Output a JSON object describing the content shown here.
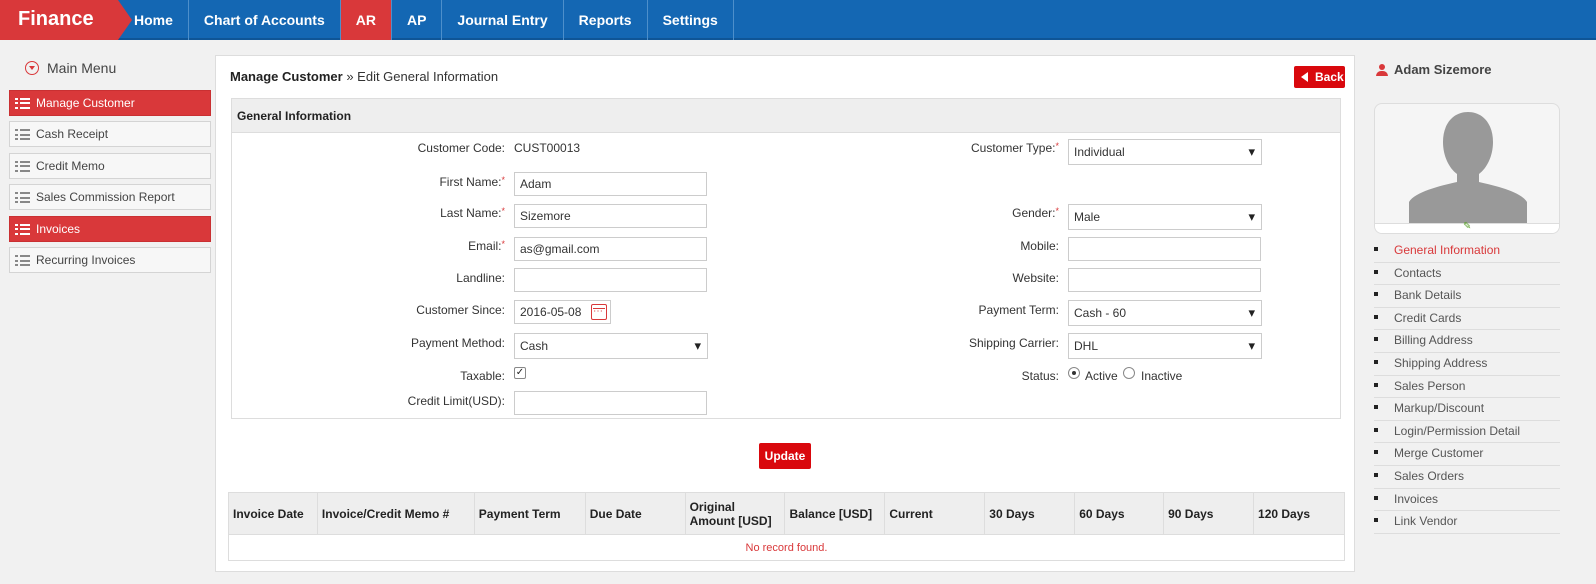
{
  "brand": "Finance",
  "nav": [
    {
      "label": "Home",
      "active": false
    },
    {
      "label": "Chart of Accounts",
      "active": false
    },
    {
      "label": "AR",
      "active": true
    },
    {
      "label": "AP",
      "active": false
    },
    {
      "label": "Journal Entry",
      "active": false
    },
    {
      "label": "Reports",
      "active": false
    },
    {
      "label": "Settings",
      "active": false
    }
  ],
  "left_menu": {
    "title": "Main Menu",
    "items": [
      {
        "label": "Manage Customer",
        "active": true
      },
      {
        "label": "Cash Receipt",
        "active": false
      },
      {
        "label": "Credit Memo",
        "active": false
      },
      {
        "label": "Sales Commission Report",
        "active": false
      },
      {
        "label": "Invoices",
        "active": true
      },
      {
        "label": "Recurring Invoices",
        "active": false
      }
    ]
  },
  "main": {
    "breadcrumb_root": "Manage Customer",
    "breadcrumb_sep": " » ",
    "breadcrumb_current": "Edit General Information",
    "back_label": "Back",
    "section_title": "General Information",
    "update_label": "Update"
  },
  "form": {
    "customer_code_label": "Customer Code:",
    "customer_code": "CUST00013",
    "first_name_label": "First Name:",
    "first_name": "Adam",
    "last_name_label": "Last Name:",
    "last_name": "Sizemore",
    "email_label": "Email:",
    "email": "as@gmail.com",
    "landline_label": "Landline:",
    "landline": "",
    "customer_since_label": "Customer Since:",
    "customer_since": "2016-05-08",
    "payment_method_label": "Payment Method:",
    "payment_method": "Cash",
    "taxable_label": "Taxable:",
    "taxable": true,
    "credit_limit_label": "Credit Limit(USD):",
    "credit_limit": "",
    "customer_type_label": "Customer Type:",
    "customer_type": "Individual",
    "gender_label": "Gender:",
    "gender": "Male",
    "mobile_label": "Mobile:",
    "mobile": "",
    "website_label": "Website:",
    "website": "",
    "payment_term_label": "Payment Term:",
    "payment_term": "Cash - 60",
    "shipping_carrier_label": "Shipping Carrier:",
    "shipping_carrier": "DHL",
    "status_label": "Status:",
    "status_active": "Active",
    "status_inactive": "Inactive",
    "status_value": "Active",
    "required_mark": "*"
  },
  "table": {
    "columns": [
      "Invoice Date",
      "Invoice/Credit Memo #",
      "Payment Term",
      "Due Date",
      "Original Amount [USD]",
      "Balance [USD]",
      "Current",
      "30 Days",
      "60 Days",
      "90 Days",
      "120 Days"
    ],
    "empty_message": "No record found."
  },
  "right_panel": {
    "user_name": "Adam Sizemore",
    "links": [
      {
        "label": "General Information",
        "active": true
      },
      {
        "label": "Contacts",
        "active": false
      },
      {
        "label": "Bank Details",
        "active": false
      },
      {
        "label": "Credit Cards",
        "active": false
      },
      {
        "label": "Billing Address",
        "active": false
      },
      {
        "label": "Shipping Address",
        "active": false
      },
      {
        "label": "Sales Person",
        "active": false
      },
      {
        "label": "Markup/Discount",
        "active": false
      },
      {
        "label": "Login/Permission Detail",
        "active": false
      },
      {
        "label": "Merge Customer",
        "active": false
      },
      {
        "label": "Sales Orders",
        "active": false
      },
      {
        "label": "Invoices",
        "active": false
      },
      {
        "label": "Link Vendor",
        "active": false
      }
    ]
  },
  "colors": {
    "brand_red": "#d9383a",
    "nav_blue": "#1467b3",
    "button_red": "#d9080d"
  }
}
